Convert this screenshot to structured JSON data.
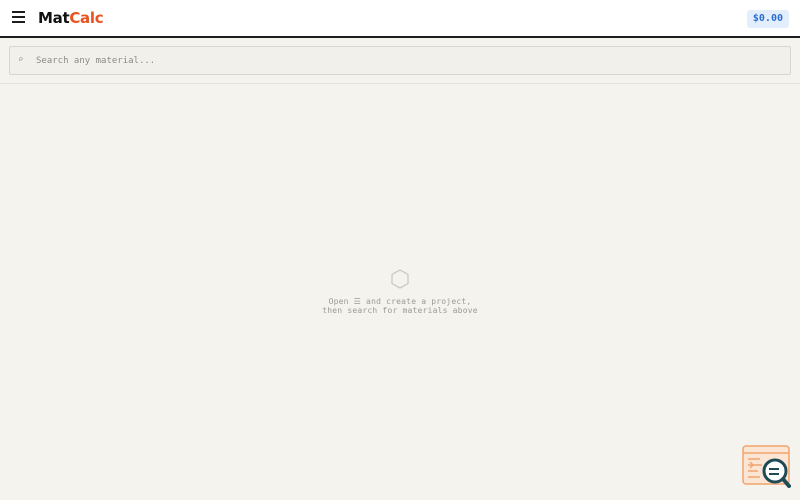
{
  "header": {
    "logo_part1": "Mat",
    "logo_part2": "Calc",
    "total": "$0.00",
    "menu_icon": "hamburger-icon"
  },
  "search": {
    "placeholder": "Search any material...",
    "value": "",
    "icon": "search-icon"
  },
  "empty_state": {
    "icon": "cube-icon",
    "line1": "Open ☰ and create a project,",
    "line2": "then search for materials above"
  },
  "widget": {
    "icon": "code-search-icon"
  },
  "colors": {
    "accent_orange": "#e8531f",
    "price_blue": "#2b6fd0",
    "background": "#f4f3ee"
  }
}
